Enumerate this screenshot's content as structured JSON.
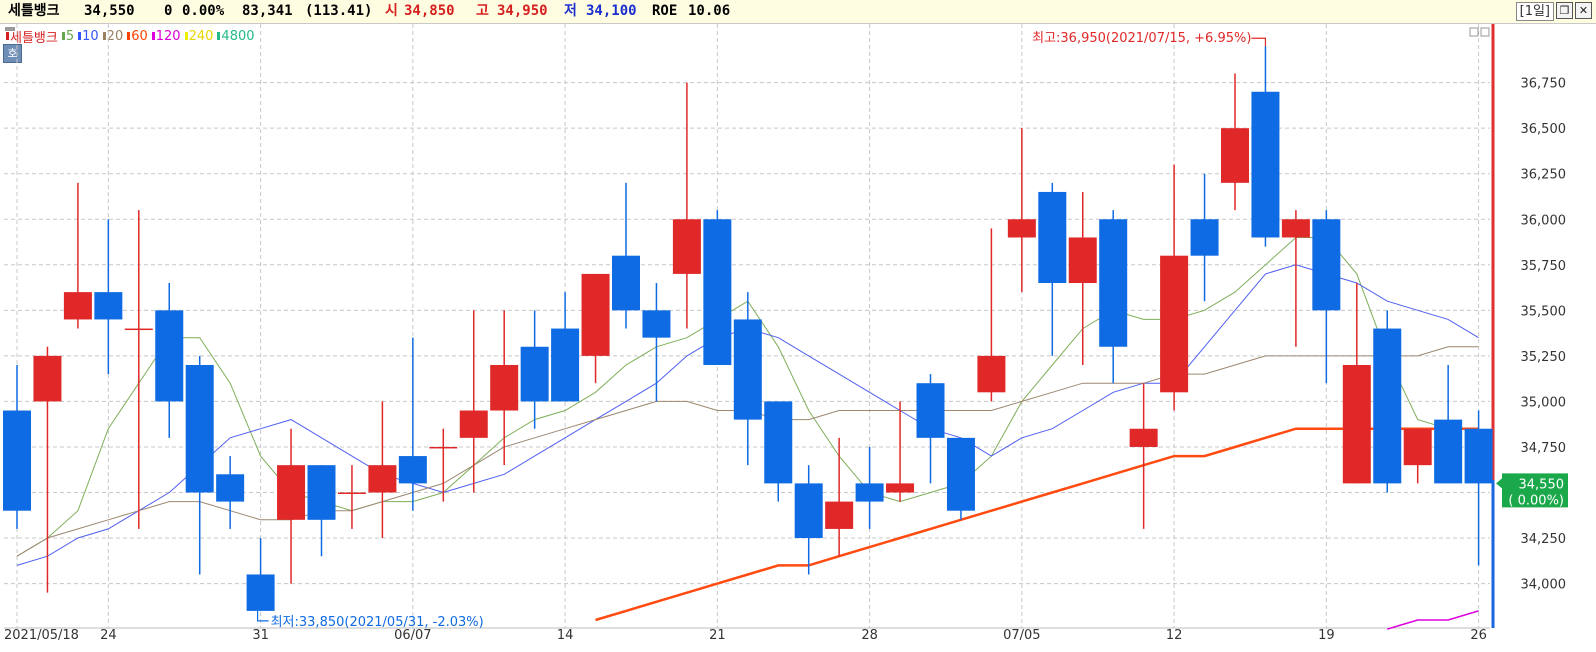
{
  "quote": {
    "name": "세틀뱅크",
    "price": "34,550",
    "change": "0",
    "change_pct": "0.00%",
    "volume": "83,341",
    "volume_ratio": "(113.41)",
    "open_label": "시",
    "open": "34,850",
    "high_label": "고",
    "high": "34,950",
    "low_label": "저",
    "low": "34,100",
    "roe_label": "ROE",
    "roe": "10.06"
  },
  "window": {
    "period": "[1일]",
    "restore_icon": "restore-icon",
    "close_icon": "close-icon"
  },
  "ho_button": "호",
  "legend": [
    {
      "label": "세틀뱅크",
      "color": "#d62020"
    },
    {
      "label": "5",
      "color": "#6aa84f"
    },
    {
      "label": "10",
      "color": "#3355ff"
    },
    {
      "label": "20",
      "color": "#9a8060"
    },
    {
      "label": "60",
      "color": "#ff4400"
    },
    {
      "label": "120",
      "color": "#dd00dd"
    },
    {
      "label": "240",
      "color": "#eeee00"
    },
    {
      "label": "4800",
      "color": "#22bb88"
    }
  ],
  "colors": {
    "up": "#e02828",
    "down": "#0f6be3",
    "ma5": "#7fae5a",
    "ma10": "#4f5ff0",
    "ma20": "#9c8670",
    "ma60": "#ff4a10",
    "ma120": "#dd00dd",
    "grid": "#c8c8c8",
    "price_tag": "#1aa84a"
  },
  "chart_data": {
    "type": "candlestick",
    "title": "",
    "xlabel": "",
    "ylabel": "",
    "ylim": [
      33800,
      37050
    ],
    "y_ticks": [
      "34,000",
      "34,250",
      "34,500",
      "34,750",
      "35,000",
      "35,250",
      "35,500",
      "35,750",
      "36,000",
      "36,250",
      "36,500",
      "36,750"
    ],
    "y_tick_values": [
      34000,
      34250,
      34500,
      34750,
      35000,
      35250,
      35500,
      35750,
      36000,
      36250,
      36500,
      36750
    ],
    "x_labels": [
      {
        "index": 0,
        "text": "2021/05/18"
      },
      {
        "index": 3,
        "text": "24"
      },
      {
        "index": 8,
        "text": "31"
      },
      {
        "index": 13,
        "text": "06/07"
      },
      {
        "index": 18,
        "text": "14"
      },
      {
        "index": 23,
        "text": "21"
      },
      {
        "index": 28,
        "text": "28"
      },
      {
        "index": 33,
        "text": "07/05"
      },
      {
        "index": 38,
        "text": "12"
      },
      {
        "index": 43,
        "text": "19"
      },
      {
        "index": 48,
        "text": "26"
      }
    ],
    "candles": [
      {
        "o": 34950,
        "h": 35200,
        "l": 34300,
        "c": 34400
      },
      {
        "o": 35000,
        "h": 35300,
        "l": 33950,
        "c": 35250
      },
      {
        "o": 35450,
        "h": 36200,
        "l": 35400,
        "c": 35600
      },
      {
        "o": 35600,
        "h": 36000,
        "l": 35150,
        "c": 35450
      },
      {
        "o": 35400,
        "h": 36050,
        "l": 34300,
        "c": 35400
      },
      {
        "o": 35500,
        "h": 35650,
        "l": 34800,
        "c": 35000
      },
      {
        "o": 35200,
        "h": 35250,
        "l": 34050,
        "c": 34500
      },
      {
        "o": 34600,
        "h": 34700,
        "l": 34300,
        "c": 34450
      },
      {
        "o": 34050,
        "h": 34250,
        "l": 33850,
        "c": 33850
      },
      {
        "o": 34350,
        "h": 34850,
        "l": 34000,
        "c": 34650
      },
      {
        "o": 34650,
        "h": 34650,
        "l": 34150,
        "c": 34350
      },
      {
        "o": 34500,
        "h": 34650,
        "l": 34300,
        "c": 34500
      },
      {
        "o": 34500,
        "h": 35000,
        "l": 34250,
        "c": 34650
      },
      {
        "o": 34700,
        "h": 35350,
        "l": 34400,
        "c": 34550
      },
      {
        "o": 34750,
        "h": 34850,
        "l": 34450,
        "c": 34750
      },
      {
        "o": 34800,
        "h": 35500,
        "l": 34500,
        "c": 34950
      },
      {
        "o": 34950,
        "h": 35500,
        "l": 34650,
        "c": 35200
      },
      {
        "o": 35300,
        "h": 35500,
        "l": 34850,
        "c": 35000
      },
      {
        "o": 35400,
        "h": 35600,
        "l": 35050,
        "c": 35000
      },
      {
        "o": 35250,
        "h": 35700,
        "l": 35100,
        "c": 35700
      },
      {
        "o": 35800,
        "h": 36200,
        "l": 35400,
        "c": 35500
      },
      {
        "o": 35500,
        "h": 35650,
        "l": 35000,
        "c": 35350
      },
      {
        "o": 35700,
        "h": 36750,
        "l": 35400,
        "c": 36000
      },
      {
        "o": 36000,
        "h": 36050,
        "l": 35200,
        "c": 35200
      },
      {
        "o": 35450,
        "h": 35600,
        "l": 34650,
        "c": 34900
      },
      {
        "o": 35000,
        "h": 35000,
        "l": 34450,
        "c": 34550
      },
      {
        "o": 34550,
        "h": 34650,
        "l": 34050,
        "c": 34250
      },
      {
        "o": 34300,
        "h": 34800,
        "l": 34150,
        "c": 34450
      },
      {
        "o": 34550,
        "h": 34750,
        "l": 34300,
        "c": 34450
      },
      {
        "o": 34500,
        "h": 35000,
        "l": 34450,
        "c": 34550
      },
      {
        "o": 35100,
        "h": 35150,
        "l": 34550,
        "c": 34800
      },
      {
        "o": 34800,
        "h": 34800,
        "l": 34350,
        "c": 34400
      },
      {
        "o": 35050,
        "h": 35950,
        "l": 35000,
        "c": 35250
      },
      {
        "o": 35900,
        "h": 36500,
        "l": 35600,
        "c": 36000
      },
      {
        "o": 36150,
        "h": 36200,
        "l": 35250,
        "c": 35650
      },
      {
        "o": 35650,
        "h": 36150,
        "l": 35200,
        "c": 35900
      },
      {
        "o": 36000,
        "h": 36050,
        "l": 35100,
        "c": 35300
      },
      {
        "o": 34750,
        "h": 35100,
        "l": 34300,
        "c": 34850
      },
      {
        "o": 35050,
        "h": 36300,
        "l": 34950,
        "c": 35800
      },
      {
        "o": 36000,
        "h": 36250,
        "l": 35550,
        "c": 35800
      },
      {
        "o": 36200,
        "h": 36800,
        "l": 36050,
        "c": 36500
      },
      {
        "o": 36700,
        "h": 36950,
        "l": 35850,
        "c": 35900
      },
      {
        "o": 35900,
        "h": 36050,
        "l": 35300,
        "c": 36000
      },
      {
        "o": 36000,
        "h": 36050,
        "l": 35100,
        "c": 35500
      },
      {
        "o": 34550,
        "h": 35650,
        "l": 34550,
        "c": 35200
      },
      {
        "o": 35400,
        "h": 35500,
        "l": 34500,
        "c": 34550
      },
      {
        "o": 34650,
        "h": 34850,
        "l": 34550,
        "c": 34850
      },
      {
        "o": 34900,
        "h": 35200,
        "l": 34550,
        "c": 34550
      },
      {
        "o": 34850,
        "h": 34950,
        "l": 34100,
        "c": 34550
      }
    ],
    "series": [
      {
        "name": "5",
        "values": [
          34150,
          34250,
          34400,
          34850,
          35100,
          35350,
          35350,
          35100,
          34700,
          34500,
          34450,
          34400,
          34450,
          34450,
          34500,
          34650,
          34800,
          34900,
          34950,
          35050,
          35200,
          35300,
          35350,
          35450,
          35550,
          35300,
          34950,
          34700,
          34500,
          34450,
          34500,
          34550,
          34700,
          35000,
          35200,
          35400,
          35500,
          35450,
          35450,
          35500,
          35600,
          35750,
          35900,
          35900,
          35700,
          35250,
          34900,
          34850,
          34850
        ]
      },
      {
        "name": "10",
        "values": [
          34100,
          34150,
          34250,
          34300,
          34400,
          34500,
          34650,
          34800,
          34850,
          34900,
          34800,
          34700,
          34600,
          34550,
          34500,
          34550,
          34600,
          34700,
          34800,
          34900,
          35000,
          35100,
          35250,
          35350,
          35400,
          35350,
          35250,
          35150,
          35050,
          34950,
          34850,
          34800,
          34700,
          34800,
          34850,
          34950,
          35050,
          35100,
          35100,
          35300,
          35500,
          35700,
          35750,
          35700,
          35650,
          35550,
          35500,
          35450,
          35350
        ]
      },
      {
        "name": "20",
        "values": [
          34150,
          34250,
          34300,
          34350,
          34400,
          34450,
          34450,
          34400,
          34350,
          34350,
          34400,
          34400,
          34450,
          34500,
          34550,
          34650,
          34750,
          34800,
          34850,
          34900,
          34950,
          35000,
          35000,
          34950,
          34950,
          34900,
          34900,
          34950,
          34950,
          34950,
          34950,
          34950,
          34950,
          35000,
          35050,
          35100,
          35100,
          35100,
          35150,
          35150,
          35200,
          35250,
          35250,
          35250,
          35250,
          35250,
          35250,
          35300,
          35300
        ]
      },
      {
        "name": "60",
        "values": [
          null,
          null,
          null,
          null,
          null,
          null,
          null,
          null,
          null,
          null,
          null,
          null,
          null,
          null,
          null,
          null,
          null,
          null,
          null,
          33800,
          33850,
          33900,
          33950,
          34000,
          34050,
          34100,
          34100,
          34150,
          34200,
          34250,
          34300,
          34350,
          34400,
          34450,
          34500,
          34550,
          34600,
          34650,
          34700,
          34700,
          34750,
          34800,
          34850,
          34850,
          34850,
          34850,
          34850,
          34850,
          34850
        ]
      },
      {
        "name": "120",
        "values": [
          null,
          null,
          null,
          null,
          null,
          null,
          null,
          null,
          null,
          null,
          null,
          null,
          null,
          null,
          null,
          null,
          null,
          null,
          null,
          null,
          null,
          null,
          null,
          null,
          null,
          null,
          null,
          null,
          null,
          null,
          null,
          null,
          null,
          null,
          null,
          null,
          null,
          null,
          null,
          null,
          null,
          null,
          null,
          null,
          null,
          33750,
          33800,
          33800,
          33850
        ]
      }
    ],
    "annotations": [
      {
        "text": "최고:36,950(2021/07/15, +6.95%)",
        "index": 41,
        "value": 36950
      },
      {
        "text": "최저:33,850(2021/05/31, -2.03%)",
        "index": 8,
        "value": 33850
      }
    ],
    "price_tag": {
      "price": "34,550",
      "change": "( 0.00%)",
      "value": 34550
    },
    "grid": true,
    "legend_position": "top-left"
  }
}
